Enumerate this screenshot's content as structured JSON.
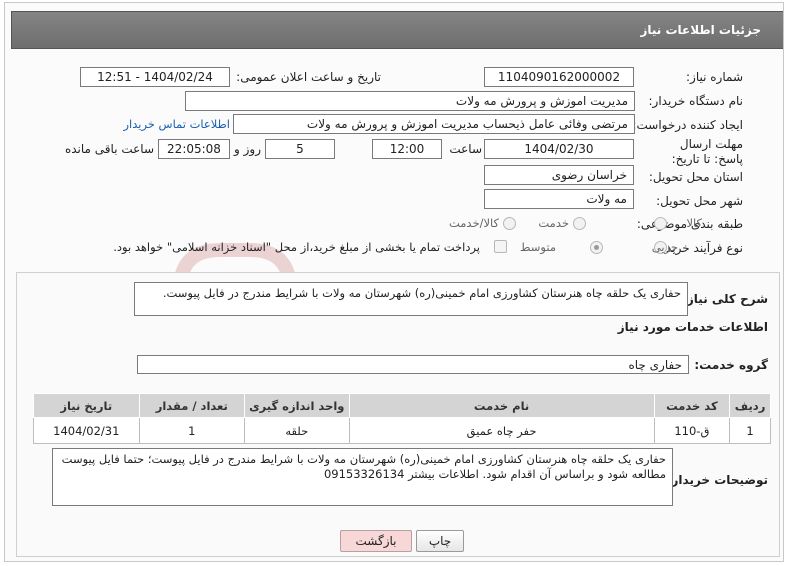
{
  "header": {
    "title": "جزئیات اطلاعات نیاز"
  },
  "form": {
    "need_number_label": "شماره نیاز:",
    "need_number": "1104090162000002",
    "announce_label": "تاریخ و ساعت اعلان عمومی:",
    "announce_value": "1404/02/24 - 12:51",
    "buyer_org_label": "نام دستگاه خریدار:",
    "buyer_org": "مدیریت اموزش و پرورش مه ولات",
    "creator_label": "ایجاد کننده درخواست:",
    "creator": "مرتضی وفائی عامل ذیحساب مدیریت اموزش و پرورش مه ولات",
    "contact_link": "اطلاعات تماس خریدار",
    "deadline_label": "مهلت ارسال پاسخ: تا تاریخ:",
    "deadline_date": "1404/02/30",
    "time_label": "ساعت",
    "deadline_time": "12:00",
    "days_value": "5",
    "days_label": "روز و",
    "remaining_time": "22:05:08",
    "remaining_label": "ساعت باقی مانده",
    "province_label": "استان محل تحویل:",
    "province": "خراسان رضوی",
    "city_label": "شهر محل تحویل:",
    "city": "مه ولات",
    "category_label": "طبقه بندی موضوعی:",
    "category_options": [
      "کالا",
      "خدمت",
      "کالا/خدمت"
    ],
    "process_label": "نوع فرآیند خرید :",
    "process_options": [
      "جزیی",
      "متوسط"
    ],
    "payment_note": "پرداخت تمام یا بخشی از مبلغ خرید،از محل \"اسناد خزانه اسلامی\" خواهد بود."
  },
  "details": {
    "summary_label": "شرح کلی نیاز:",
    "summary": "حفاری یک حلقه چاه هنرستان کشاورزی امام خمینی(ره) شهرستان مه ولات با شرایط مندرج در فایل پیوست.",
    "services_heading": "اطلاعات خدمات مورد نیاز",
    "service_group_label": "گروه خدمت:",
    "service_group": "حفاری چاه",
    "table": {
      "headers": [
        "ردیف",
        "کد خدمت",
        "نام خدمت",
        "واحد اندازه گیری",
        "تعداد / مقدار",
        "تاریخ نیاز"
      ],
      "rows": [
        [
          "1",
          "ق-110",
          "حفر چاه عمیق",
          "حلقه",
          "1",
          "1404/02/31"
        ]
      ]
    },
    "buyer_notes_label": "توضیحات خریدار:",
    "buyer_notes": "حفاری یک حلقه چاه هنرستان کشاورزی امام خمینی(ره) شهرستان مه ولات با شرایط مندرج در فایل پیوست؛ حتما فایل پیوست مطالعه شود و براساس آن اقدام شود. اطلاعات بیشتر 09153326134"
  },
  "buttons": {
    "print": "چاپ",
    "back": "بازگشت"
  },
  "colors": {
    "title_bar": "#777777",
    "link": "#1a5fb4",
    "back_button": "#f7d7d7",
    "watermark": "#e8c8c8"
  }
}
